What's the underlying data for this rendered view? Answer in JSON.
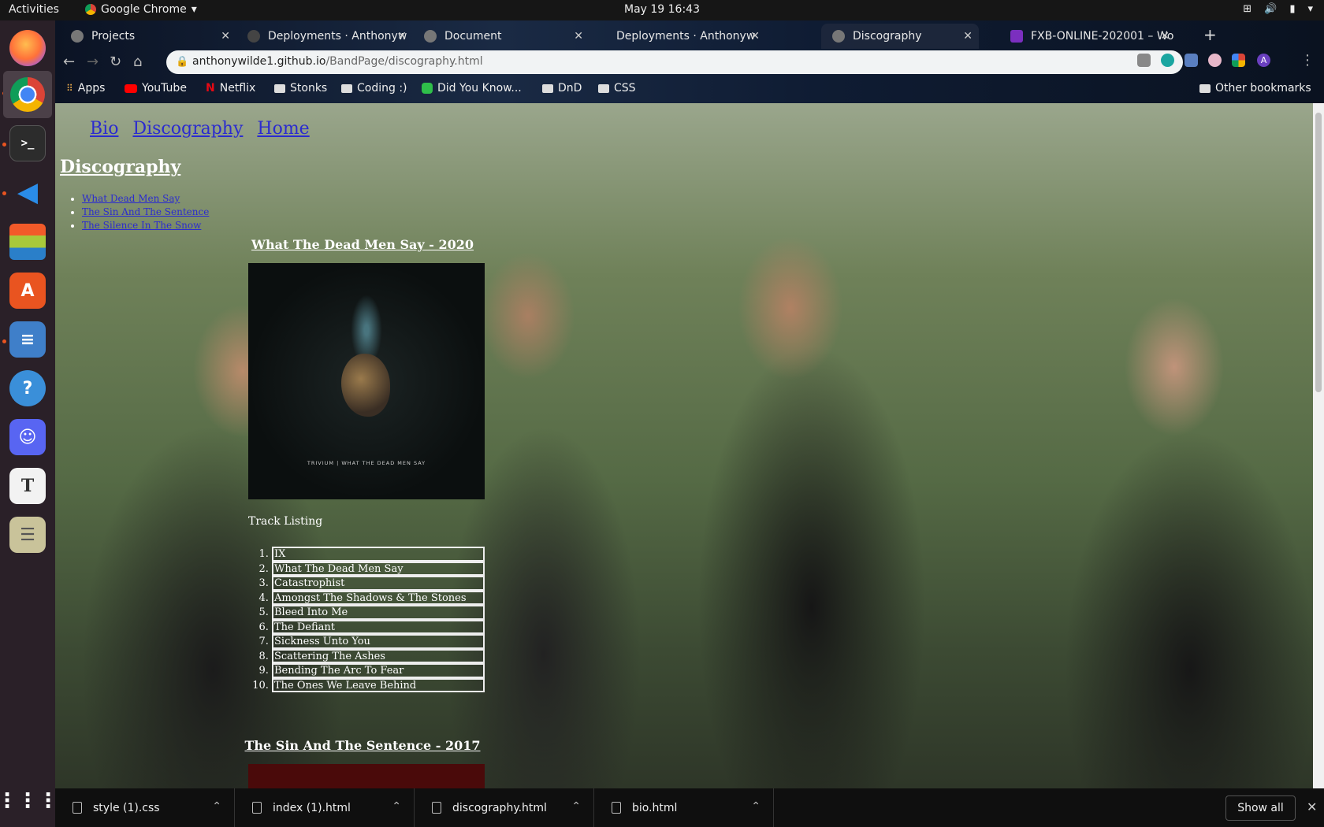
{
  "system": {
    "activities": "Activities",
    "app_name": "Google Chrome",
    "clock": "May 19  16:43"
  },
  "dock": {
    "items": [
      "firefox-icon",
      "chrome-icon",
      "terminal-icon",
      "vscode-icon",
      "layers-icon",
      "software-icon",
      "notes-icon",
      "help-icon",
      "discord-icon",
      "typora-icon",
      "files-icon",
      "app-grid-icon"
    ]
  },
  "tabs": [
    {
      "title": "Projects"
    },
    {
      "title": "Deployments · Anthonyw"
    },
    {
      "title": "Document"
    },
    {
      "title": "Deployments · Anthonyw"
    },
    {
      "title": "Discography"
    },
    {
      "title": "FXB-ONLINE-202001 – Wo"
    }
  ],
  "omnibox": {
    "host": "anthonywilde1.github.io",
    "path": "/BandPage/discography.html"
  },
  "bookmarks": [
    "Apps",
    "YouTube",
    "Netflix",
    "Stonks",
    "Coding :)",
    "Did You Know...",
    "DnD",
    "CSS"
  ],
  "bookmarks_other": "Other bookmarks",
  "page": {
    "nav": [
      "Bio",
      "Discography",
      "Home"
    ],
    "heading": "Discography",
    "toc": [
      "What Dead Men Say",
      "The Sin And The Sentence",
      "The Silence In The Snow"
    ],
    "album1": {
      "title": "What The Dead Men Say - 2020",
      "cover_caption": "TRIVIUM  |  WHAT THE DEAD MEN SAY",
      "track_heading": "Track Listing",
      "tracks": [
        "IX",
        "What The Dead Men Say",
        "Catastrophist",
        "Amongst The Shadows & The Stones",
        "Bleed Into Me",
        "The Defiant",
        "Sickness Unto You",
        "Scattering The Ashes",
        "Bending The Arc To Fear",
        "The Ones We Leave Behind"
      ]
    },
    "album2": {
      "title": "The Sin And The Sentence - 2017"
    }
  },
  "downloads": {
    "files": [
      "style (1).css",
      "index (1).html",
      "discography.html",
      "bio.html"
    ],
    "show_all": "Show all"
  }
}
